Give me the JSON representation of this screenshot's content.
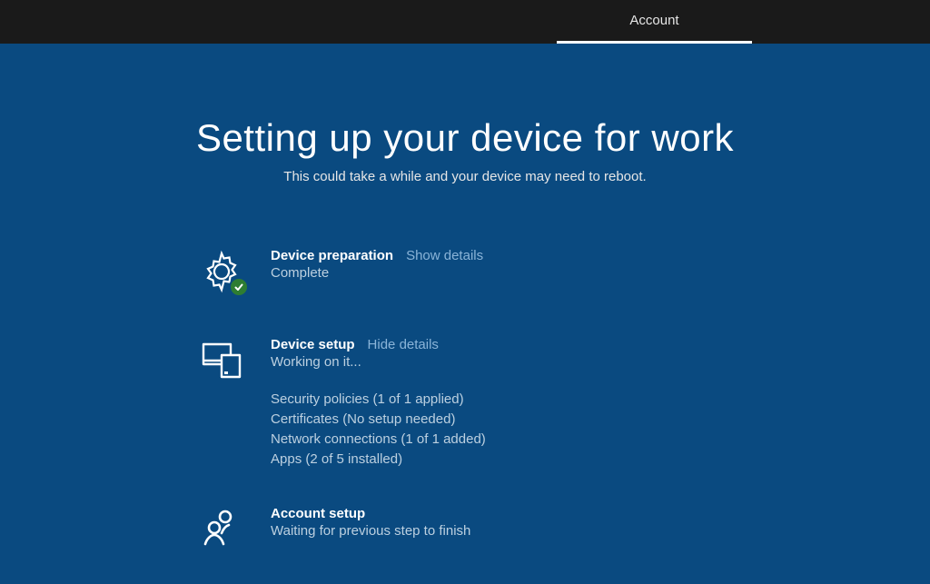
{
  "topbar": {
    "tab_account": "Account"
  },
  "header": {
    "title": "Setting up your device for work",
    "subtitle": "This could take a while and your device may need to reboot."
  },
  "steps": {
    "preparation": {
      "title": "Device preparation",
      "link": "Show details",
      "status": "Complete"
    },
    "setup": {
      "title": "Device setup",
      "link": "Hide details",
      "status": "Working on it...",
      "details": {
        "security": "Security policies (1 of 1 applied)",
        "certificates": "Certificates (No setup needed)",
        "network": "Network connections (1 of 1 added)",
        "apps": "Apps (2 of 5 installed)"
      }
    },
    "account": {
      "title": "Account setup",
      "status": "Waiting for previous step to finish"
    }
  }
}
